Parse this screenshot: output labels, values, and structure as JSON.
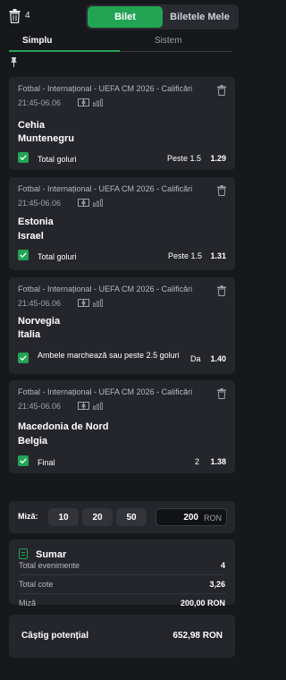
{
  "header": {
    "bet_count": "4",
    "toggle_active": "Bilet",
    "toggle_inactive": "Biletele Mele"
  },
  "tabs": {
    "simplu": "Simplu",
    "sistem": "Sistem"
  },
  "bets": [
    {
      "league": "Fotbal - Internațional - UEFA CM 2026 - Calificări",
      "time": "21:45-06.06",
      "team1": "Cehia",
      "team2": "Muntenegru",
      "market": "Total goluri",
      "selection": "Peste 1.5",
      "odd": "1.29"
    },
    {
      "league": "Fotbal - Internațional - UEFA CM 2026 - Calificări",
      "time": "21:45-06.06",
      "team1": "Estonia",
      "team2": "Israel",
      "market": "Total goluri",
      "selection": "Peste 1.5",
      "odd": "1.31"
    },
    {
      "league": "Fotbal - Internațional - UEFA CM 2026 - Calificări",
      "time": "21:45-06.06",
      "team1": "Norvegia",
      "team2": "Italia",
      "market": "Ambele marchează sau peste 2.5 goluri",
      "selection": "Da",
      "odd": "1.40"
    },
    {
      "league": "Fotbal - Internațional - UEFA CM 2026 - Calificări",
      "time": "21:45-06.06",
      "team1": "Macedonia de Nord",
      "team2": "Belgia",
      "market": "Final",
      "selection": "2",
      "odd": "1.38"
    }
  ],
  "stake": {
    "label": "Miză:",
    "quick": [
      "10",
      "20",
      "50"
    ],
    "value": "200",
    "currency": "RON"
  },
  "summary": {
    "title": "Sumar",
    "rows": [
      {
        "label": "Total evenimente",
        "value": "4"
      },
      {
        "label": "Total cote",
        "value": "3,26"
      },
      {
        "label": "Miză",
        "value": "200,00 RON"
      }
    ]
  },
  "winnings": {
    "label": "Câștig potențial",
    "value": "652,98 RON"
  },
  "colors": {
    "accent": "#22a454",
    "background": "#17181c",
    "card": "#25262b"
  }
}
